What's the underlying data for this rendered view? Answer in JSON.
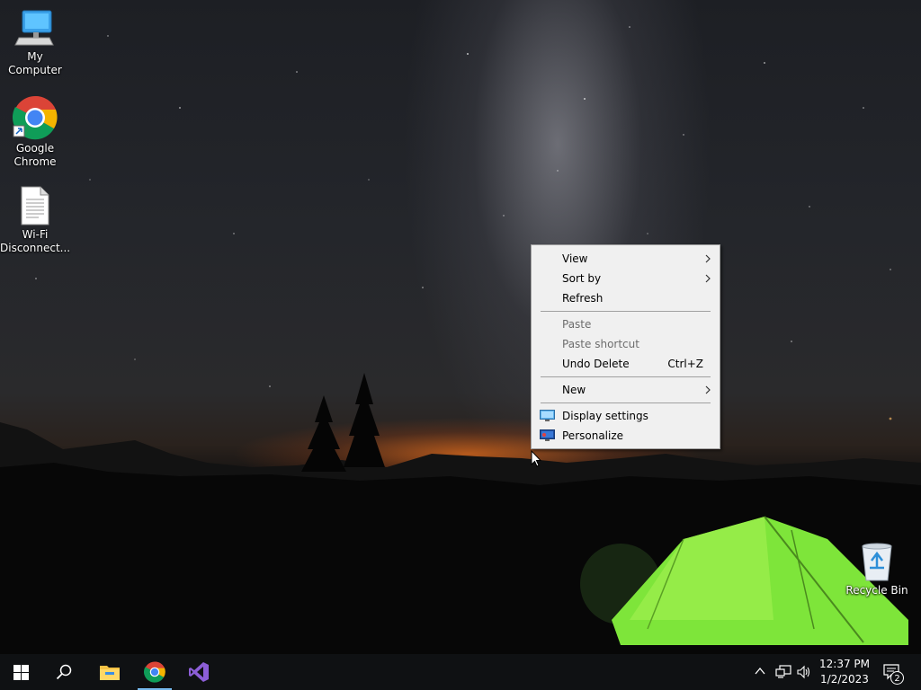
{
  "desktop": {
    "icons": [
      {
        "label": "My Computer"
      },
      {
        "label": "Google Chrome"
      },
      {
        "label": "Wi-Fi Disconnect..."
      },
      {
        "label": "Recycle Bin"
      }
    ]
  },
  "context_menu": {
    "items": [
      {
        "label": "View",
        "submenu": true
      },
      {
        "label": "Sort by",
        "submenu": true
      },
      {
        "label": "Refresh"
      },
      {
        "label": "Paste",
        "disabled": true
      },
      {
        "label": "Paste shortcut",
        "disabled": true
      },
      {
        "label": "Undo Delete",
        "shortcut": "Ctrl+Z"
      },
      {
        "label": "New",
        "submenu": true
      },
      {
        "label": "Display settings",
        "icon": "display-settings-icon"
      },
      {
        "label": "Personalize",
        "icon": "personalize-icon"
      }
    ]
  },
  "taskbar": {
    "buttons": [
      {
        "icon": "windows-start-icon"
      },
      {
        "icon": "search-icon"
      },
      {
        "icon": "file-explorer-icon"
      },
      {
        "icon": "chrome-icon",
        "active": true
      },
      {
        "icon": "visual-studio-icon"
      }
    ],
    "tray": {
      "icons": [
        "chevron-up-icon",
        "network-icon",
        "volume-icon"
      ],
      "time": "12:37 PM",
      "date": "1/2/2023",
      "notification_count": "2"
    }
  },
  "colors": {
    "accent": "#76b9ed",
    "taskbar": "#0f1113",
    "menu_bg": "#f0f0f0",
    "tent_green": "#7ee53a"
  }
}
